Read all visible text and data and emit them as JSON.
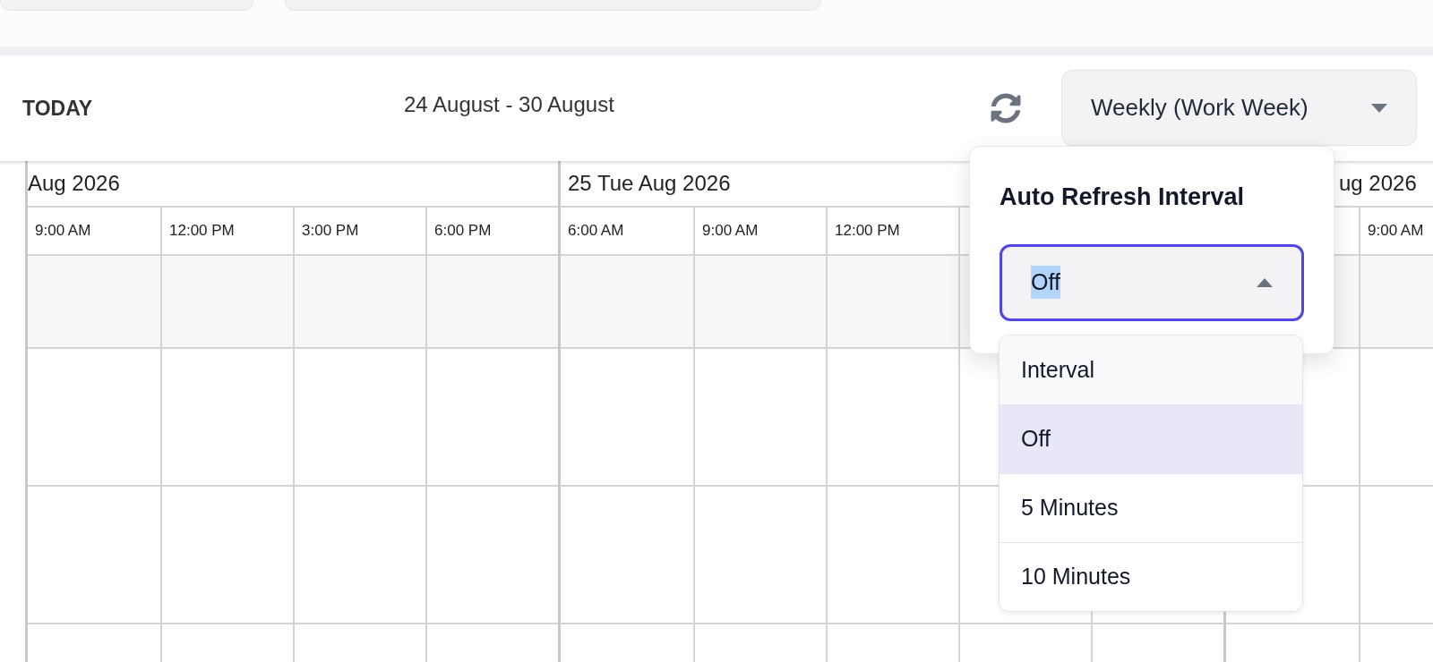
{
  "toolbar": {
    "today_button": "TODAY",
    "date_range": "24 August - 30 August",
    "view_select": {
      "value": "Weekly (Work Week)",
      "expanded": false
    }
  },
  "calendar": {
    "days": [
      {
        "title": "Aug 2026",
        "slots": [
          "9:00 AM",
          "12:00 PM",
          "3:00 PM",
          "6:00 PM"
        ]
      },
      {
        "title": "25 Tue Aug 2026",
        "slots": [
          "6:00 AM",
          "9:00 AM",
          "12:00 PM"
        ]
      },
      {
        "title": "ug 2026",
        "slots": [
          "9:00 AM"
        ]
      }
    ]
  },
  "refresh_popup": {
    "title": "Auto Refresh Interval",
    "select": {
      "value": "Off",
      "expanded": true
    },
    "options": [
      {
        "label": "Interval",
        "kind": "header",
        "selected": false
      },
      {
        "label": "Off",
        "kind": "option",
        "selected": true
      },
      {
        "label": "5 Minutes",
        "kind": "option",
        "selected": false
      },
      {
        "label": "10 Minutes",
        "kind": "option",
        "selected": false
      }
    ]
  }
}
